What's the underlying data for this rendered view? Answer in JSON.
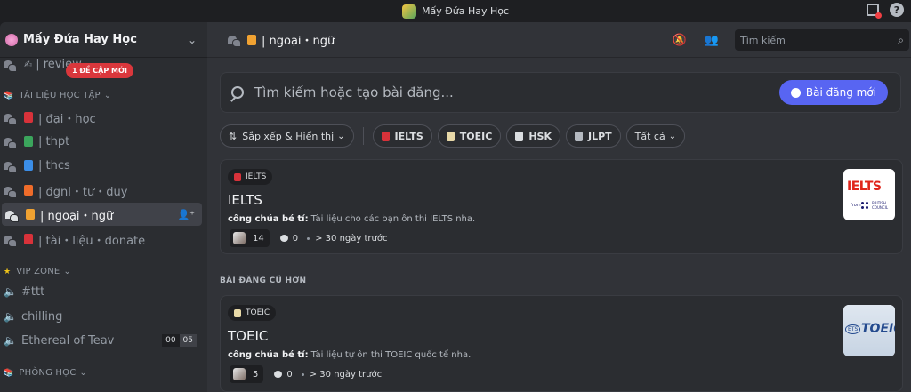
{
  "window": {
    "title": "Mấy Đứa Hay Học"
  },
  "sidebar": {
    "server_name": "Mấy Đứa Hay Học",
    "review_channel": "| review",
    "mention_badge": "1 ĐỀ CẬP MỚI",
    "categories": {
      "tai_lieu": "TÀI LIỆU HỌC TẬP",
      "vip": "VIP ZONE",
      "phong_hoc": "PHÒNG HỌC"
    },
    "forum_channels": [
      {
        "label": "| đại・học",
        "color": "#d8323a"
      },
      {
        "label": "| thpt",
        "color": "#3ba55c"
      },
      {
        "label": "| thcs",
        "color": "#3b8ee8"
      },
      {
        "label": "| đgnl・tư・duy",
        "color": "#ef6c2a"
      },
      {
        "label": "| ngoại・ngữ",
        "color": "#f0a232"
      },
      {
        "label": "| tài・liệu・donate",
        "color": "#d8323a"
      }
    ],
    "voice_channels": [
      {
        "label": "#ttt"
      },
      {
        "label": "chilling"
      },
      {
        "label": "Ethereal of Teav",
        "counter": [
          "00",
          "05"
        ]
      }
    ]
  },
  "channel": {
    "name": "| ngoại・ngữ",
    "search_placeholder": "Tìm kiếm"
  },
  "forum": {
    "search_placeholder": "Tìm kiếm hoặc tạo bài đăng...",
    "new_post_label": "Bài đăng mới",
    "sort_label": "Sắp xếp & Hiển thị",
    "tags": [
      {
        "label": "IELTS",
        "color": "#d8323a"
      },
      {
        "label": "TOEIC",
        "color": "#e8d9a8"
      },
      {
        "label": "HSK",
        "color": "#dbdee1"
      },
      {
        "label": "JLPT",
        "color": "#b5bac1"
      }
    ],
    "all_label": "Tất cả",
    "older_section": "BÀI ĐĂNG CŨ HƠN",
    "posts": [
      {
        "tag": "IELTS",
        "title": "IELTS",
        "author": "công chúa bé tí:",
        "snippet": "Tài liệu cho các bạn ôn thi IELTS nha.",
        "reactions": "14",
        "messages": "0",
        "time": "> 30 ngày trước",
        "thumb_text": "IELTS",
        "thumb_from": "from",
        "thumb_bc": "BRITISH COUNCIL"
      },
      {
        "tag": "TOEIC",
        "title": "TOEIC",
        "author": "công chúa bé tí:",
        "snippet": "Tài liệu tự ôn thi TOEIC quốc tế nha.",
        "reactions": "5",
        "messages": "0",
        "time": "> 30 ngày trước",
        "thumb_ets": "ETS",
        "thumb_text": "TOEIC"
      }
    ]
  }
}
